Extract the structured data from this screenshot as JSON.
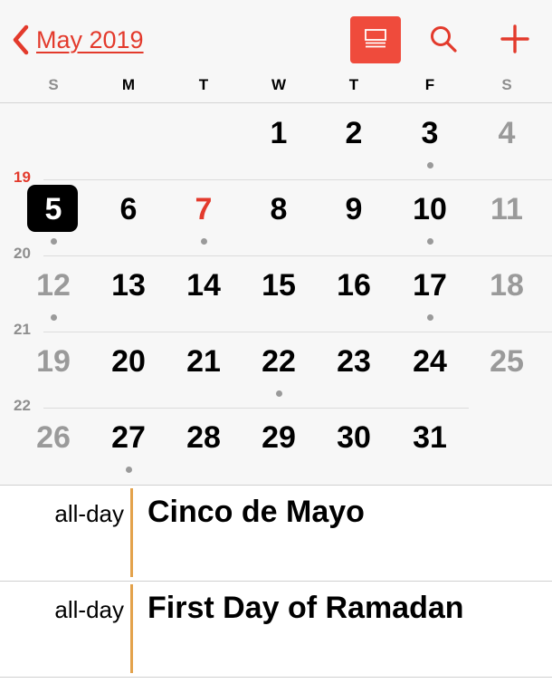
{
  "nav": {
    "month_title": "May 2019",
    "back_icon": "chevron-left-icon",
    "list_toggle_icon": "list-view-icon",
    "search_icon": "search-icon",
    "add_icon": "plus-icon",
    "accent_color": "#e33a2c"
  },
  "weekdays": [
    "S",
    "M",
    "T",
    "W",
    "T",
    "F",
    "S"
  ],
  "weeks": [
    {
      "week_number": "",
      "days": [
        {
          "num": "",
          "dot": false
        },
        {
          "num": "",
          "dot": false
        },
        {
          "num": "",
          "dot": false
        },
        {
          "num": "1",
          "dot": false
        },
        {
          "num": "2",
          "dot": false
        },
        {
          "num": "3",
          "dot": true
        },
        {
          "num": "4",
          "dot": false
        }
      ]
    },
    {
      "week_number": "19",
      "days": [
        {
          "num": "5",
          "dot": true,
          "selected": true
        },
        {
          "num": "6",
          "dot": false
        },
        {
          "num": "7",
          "dot": true,
          "today": true
        },
        {
          "num": "8",
          "dot": false
        },
        {
          "num": "9",
          "dot": false
        },
        {
          "num": "10",
          "dot": true
        },
        {
          "num": "11",
          "dot": false
        }
      ]
    },
    {
      "week_number": "20",
      "days": [
        {
          "num": "12",
          "dot": true
        },
        {
          "num": "13",
          "dot": false
        },
        {
          "num": "14",
          "dot": false
        },
        {
          "num": "15",
          "dot": false
        },
        {
          "num": "16",
          "dot": false
        },
        {
          "num": "17",
          "dot": true
        },
        {
          "num": "18",
          "dot": false
        }
      ]
    },
    {
      "week_number": "21",
      "days": [
        {
          "num": "19",
          "dot": false
        },
        {
          "num": "20",
          "dot": false
        },
        {
          "num": "21",
          "dot": false
        },
        {
          "num": "22",
          "dot": true
        },
        {
          "num": "23",
          "dot": false
        },
        {
          "num": "24",
          "dot": false
        },
        {
          "num": "25",
          "dot": false
        }
      ]
    },
    {
      "week_number": "22",
      "days": [
        {
          "num": "26",
          "dot": false
        },
        {
          "num": "27",
          "dot": true
        },
        {
          "num": "28",
          "dot": false
        },
        {
          "num": "29",
          "dot": false
        },
        {
          "num": "30",
          "dot": false
        },
        {
          "num": "31",
          "dot": false
        },
        {
          "num": "",
          "dot": false
        }
      ]
    }
  ],
  "events": [
    {
      "time": "all-day",
      "title": "Cinco de Mayo",
      "color": "#e3a24b"
    },
    {
      "time": "all-day",
      "title": "First Day of Ramadan",
      "color": "#e3a24b"
    }
  ]
}
